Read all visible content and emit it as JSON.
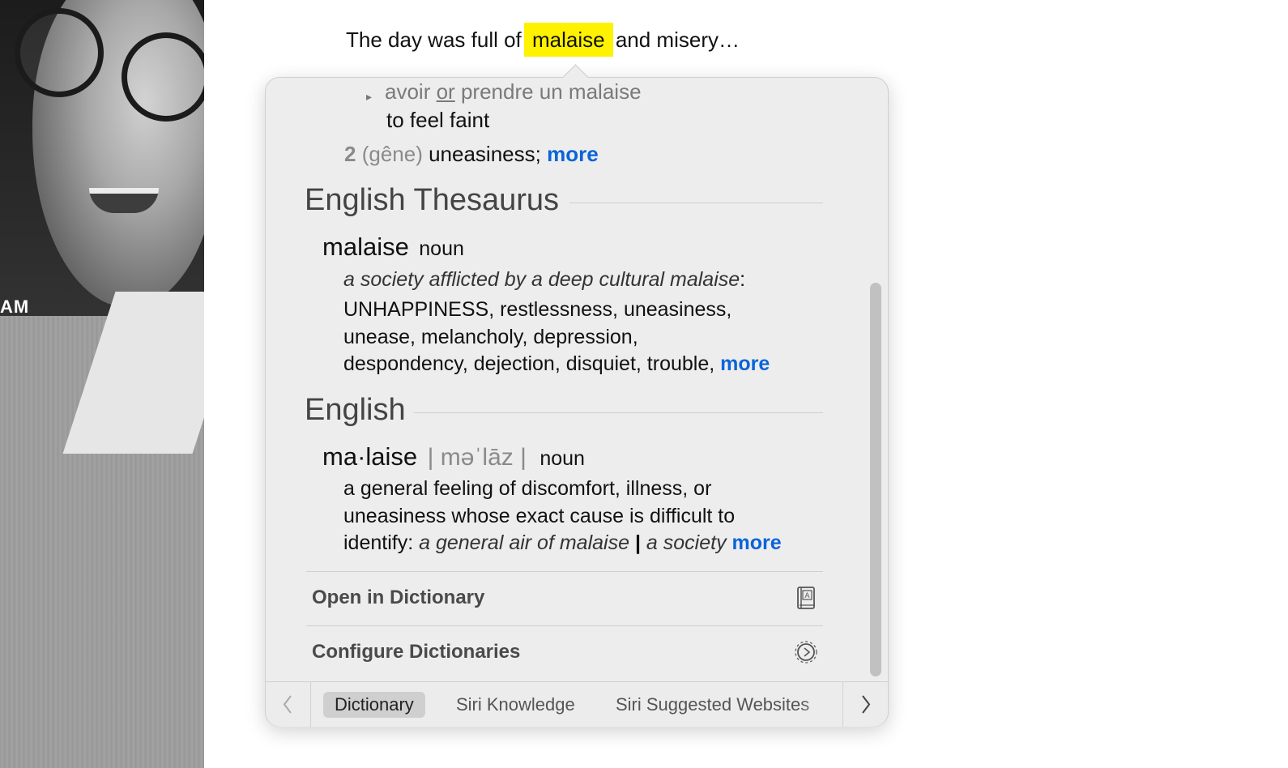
{
  "photo": {
    "overlay_text": "AM"
  },
  "sentence": {
    "before": "The day was full of ",
    "highlight": "malaise",
    "after": " and misery…",
    "highlight_color": "#fff200"
  },
  "french": {
    "phrase_part1": "avoir",
    "phrase_or": "or",
    "phrase_part2": "prendre un malaise",
    "phrase_translation": "to feel faint",
    "sense_number": "2",
    "sense_gloss": "(gêne)",
    "sense_word": "uneasiness;",
    "more": "more"
  },
  "thesaurus": {
    "title": "English Thesaurus",
    "headword": "malaise",
    "pos": "noun",
    "example": "a society afflicted by a deep cultural malaise",
    "example_colon": ":",
    "synonym_main": "UNHAPPINESS",
    "line1_rest": ", restlessness, uneasiness,",
    "line2": "unease, melancholy, depression,",
    "line3": "despondency, dejection, disquiet, trouble,",
    "more": "more"
  },
  "english": {
    "title": "English",
    "headword": "ma·laise",
    "pronunciation": "| məˈlāz |",
    "pos": "noun",
    "def_line1": "a general feeling of discomfort, illness, or",
    "def_line2": "uneasiness whose exact cause is difficult to",
    "def_line3_start": "identify:",
    "example1": "a general air of malaise",
    "separator": "|",
    "example2": "a society",
    "more": "more"
  },
  "actions": {
    "open_dictionary": "Open in Dictionary",
    "configure": "Configure Dictionaries"
  },
  "tabs": [
    {
      "label": "Dictionary",
      "active": true
    },
    {
      "label": "Siri Knowledge",
      "active": false
    },
    {
      "label": "Siri Suggested Websites",
      "active": false
    }
  ],
  "colors": {
    "link": "#0a64d8",
    "panel": "#ededed",
    "highlight": "#fff200"
  }
}
